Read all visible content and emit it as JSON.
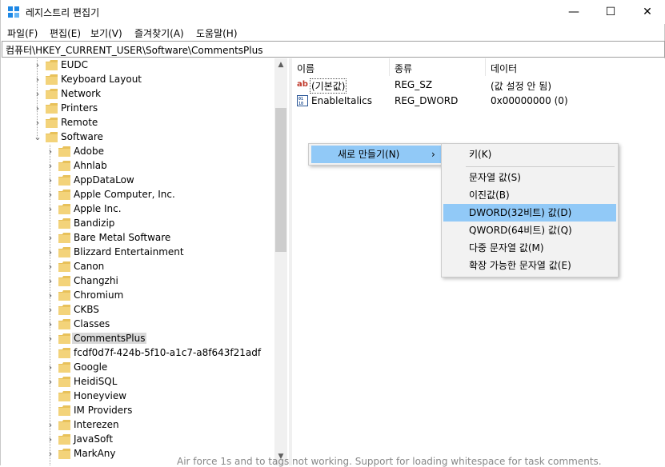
{
  "window": {
    "title": "레지스트리 편집기",
    "minimize_glyph": "—",
    "maximize_glyph": "☐",
    "close_glyph": "✕"
  },
  "menu": [
    "파일(F)",
    "편집(E)",
    "보기(V)",
    "즐겨찾기(A)",
    "도움말(H)"
  ],
  "address": "컴퓨터\\HKEY_CURRENT_USER\\Software\\CommentsPlus",
  "tree": {
    "top_items": [
      "EUDC",
      "Keyboard Layout",
      "Network",
      "Printers",
      "Remote",
      "Software"
    ],
    "software_children": [
      "Adobe",
      "Ahnlab",
      "AppDataLow",
      "Apple Computer, Inc.",
      "Apple Inc.",
      "Bandizip",
      "Bare Metal Software",
      "Blizzard Entertainment",
      "Canon",
      "Changzhi",
      "Chromium",
      "CKBS",
      "Classes",
      "CommentsPlus",
      "fcdf0d7f-424b-5f10-a1c7-a8f643f21adf",
      "Google",
      "HeidiSQL",
      "Honeyview",
      "IM Providers",
      "Interezen",
      "JavaSoft",
      "MarkAny"
    ],
    "selected": "CommentsPlus"
  },
  "list": {
    "columns": [
      "이름",
      "종류",
      "데이터"
    ],
    "rows": [
      {
        "icon": "string-value-icon",
        "name": "(기본값)",
        "type": "REG_SZ",
        "data": "(값 설정 안 됨)"
      },
      {
        "icon": "binary-value-icon",
        "name": "EnableItalics",
        "type": "REG_DWORD",
        "data": "0x00000000 (0)"
      }
    ]
  },
  "context_menu": {
    "new_label": "새로 만들기(N)",
    "submenu": {
      "key": "키(K)",
      "string": "문자열 값(S)",
      "binary": "이진값(B)",
      "dword": "DWORD(32비트) 값(D)",
      "qword": "QWORD(64비트) 값(Q)",
      "multi": "다중 문자열 값(M)",
      "expand": "확장 가능한 문자열 값(E)"
    }
  },
  "background_text": "Air force 1s and to tags not working. Support for loading whitespace for task comments.",
  "colors": {
    "highlight": "#91c9f7",
    "folder": "#e8c15a",
    "selection_gray": "#d9d9d9"
  }
}
